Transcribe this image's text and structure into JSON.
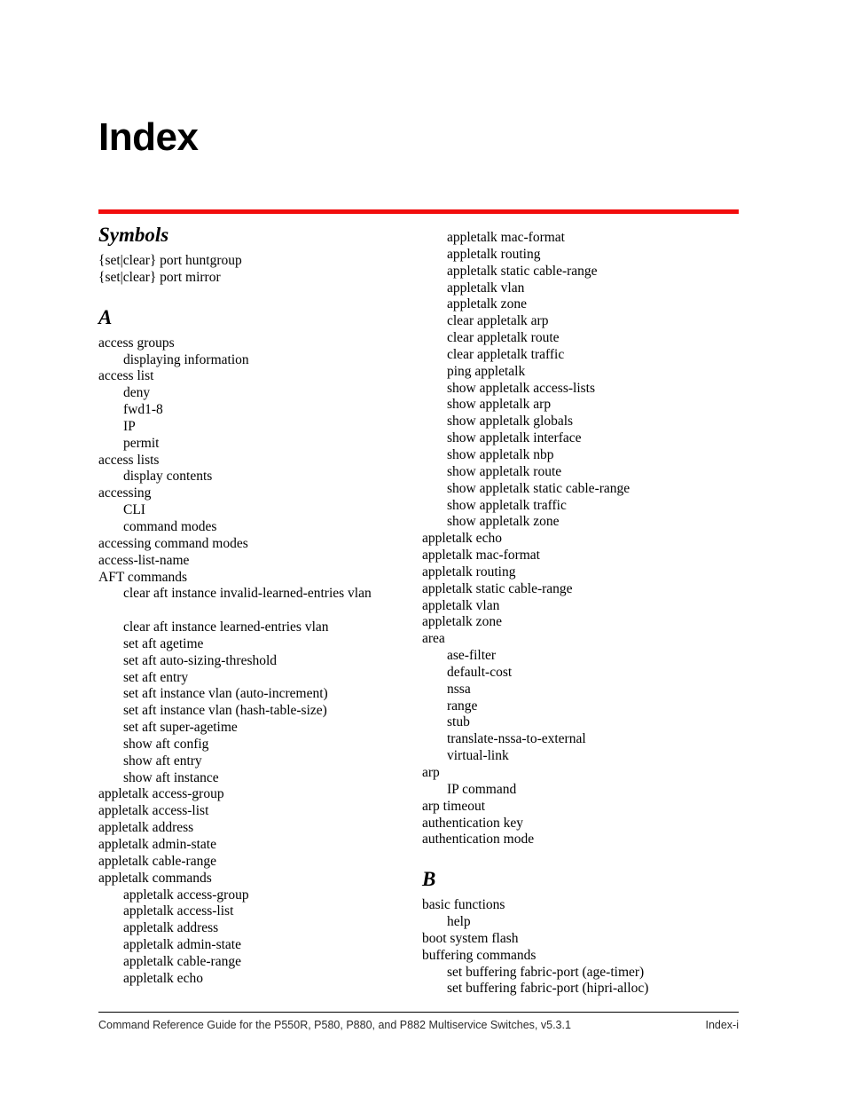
{
  "page": {
    "title": "Index",
    "accent_rule_color": "#f20d0d",
    "background_color": "#ffffff",
    "text_color": "#000000"
  },
  "columns": {
    "left": {
      "sections": [
        {
          "heading": "Symbols",
          "entries": [
            {
              "text": "{set|clear} port huntgroup",
              "level": 0
            },
            {
              "text": "{set|clear} port mirror",
              "level": 0
            }
          ]
        },
        {
          "heading": "A",
          "entries": [
            {
              "text": "access groups",
              "level": 0
            },
            {
              "text": "displaying information",
              "level": 1
            },
            {
              "text": "access list",
              "level": 0
            },
            {
              "text": "deny",
              "level": 1
            },
            {
              "text": "fwd1-8",
              "level": 1
            },
            {
              "text": "IP",
              "level": 1
            },
            {
              "text": "permit",
              "level": 1
            },
            {
              "text": "access lists",
              "level": 0
            },
            {
              "text": "display contents",
              "level": 1
            },
            {
              "text": "accessing",
              "level": 0
            },
            {
              "text": "CLI",
              "level": 1
            },
            {
              "text": "command modes",
              "level": 1
            },
            {
              "text": "accessing command modes",
              "level": 0
            },
            {
              "text": "access-list-name",
              "level": 0
            },
            {
              "text": "AFT commands",
              "level": 0
            },
            {
              "text": "clear aft instance invalid-learned-entries vlan",
              "level": 1
            },
            {
              "text": "",
              "level": 1,
              "spacer": true
            },
            {
              "text": "clear aft instance learned-entries vlan",
              "level": 1
            },
            {
              "text": "set aft agetime",
              "level": 1
            },
            {
              "text": "set aft auto-sizing-threshold",
              "level": 1
            },
            {
              "text": "set aft entry",
              "level": 1
            },
            {
              "text": "set aft instance vlan (auto-increment)",
              "level": 1
            },
            {
              "text": "set aft instance vlan (hash-table-size)",
              "level": 1
            },
            {
              "text": "set aft super-agetime",
              "level": 1
            },
            {
              "text": "show aft config",
              "level": 1
            },
            {
              "text": "show aft entry",
              "level": 1
            },
            {
              "text": "show aft instance",
              "level": 1
            },
            {
              "text": "appletalk access-group",
              "level": 0
            },
            {
              "text": "appletalk access-list",
              "level": 0
            },
            {
              "text": "appletalk address",
              "level": 0
            },
            {
              "text": "appletalk admin-state",
              "level": 0
            },
            {
              "text": "appletalk cable-range",
              "level": 0
            },
            {
              "text": "appletalk commands",
              "level": 0
            },
            {
              "text": "appletalk access-group",
              "level": 1
            },
            {
              "text": "appletalk access-list",
              "level": 1
            },
            {
              "text": "appletalk address",
              "level": 1
            },
            {
              "text": "appletalk admin-state",
              "level": 1
            },
            {
              "text": "appletalk cable-range",
              "level": 1
            },
            {
              "text": "appletalk echo",
              "level": 1
            }
          ]
        }
      ]
    },
    "right": {
      "sections": [
        {
          "heading": "",
          "entries": [
            {
              "text": "appletalk mac-format",
              "level": 1
            },
            {
              "text": "appletalk routing",
              "level": 1
            },
            {
              "text": "appletalk static cable-range",
              "level": 1
            },
            {
              "text": "appletalk vlan",
              "level": 1
            },
            {
              "text": "appletalk zone",
              "level": 1
            },
            {
              "text": "clear appletalk arp",
              "level": 1
            },
            {
              "text": "clear appletalk route",
              "level": 1
            },
            {
              "text": "clear appletalk traffic",
              "level": 1
            },
            {
              "text": "ping appletalk",
              "level": 1
            },
            {
              "text": "show appletalk access-lists",
              "level": 1
            },
            {
              "text": "show appletalk arp",
              "level": 1
            },
            {
              "text": "show appletalk globals",
              "level": 1
            },
            {
              "text": "show appletalk interface",
              "level": 1
            },
            {
              "text": "show appletalk nbp",
              "level": 1
            },
            {
              "text": "show appletalk route",
              "level": 1
            },
            {
              "text": "show appletalk static cable-range",
              "level": 1
            },
            {
              "text": "show appletalk traffic",
              "level": 1
            },
            {
              "text": "show appletalk zone",
              "level": 1
            },
            {
              "text": "appletalk echo",
              "level": 0
            },
            {
              "text": "appletalk mac-format",
              "level": 0
            },
            {
              "text": "appletalk routing",
              "level": 0
            },
            {
              "text": "appletalk static cable-range",
              "level": 0
            },
            {
              "text": "appletalk vlan",
              "level": 0
            },
            {
              "text": "appletalk zone",
              "level": 0
            },
            {
              "text": "area",
              "level": 0
            },
            {
              "text": "ase-filter",
              "level": 1
            },
            {
              "text": "default-cost",
              "level": 1
            },
            {
              "text": "nssa",
              "level": 1
            },
            {
              "text": "range",
              "level": 1
            },
            {
              "text": "stub",
              "level": 1
            },
            {
              "text": "translate-nssa-to-external",
              "level": 1
            },
            {
              "text": "virtual-link",
              "level": 1
            },
            {
              "text": "arp",
              "level": 0
            },
            {
              "text": "IP command",
              "level": 1
            },
            {
              "text": "arp timeout",
              "level": 0
            },
            {
              "text": "authentication key",
              "level": 0
            },
            {
              "text": "authentication mode",
              "level": 0
            }
          ]
        },
        {
          "heading": "B",
          "entries": [
            {
              "text": "basic functions",
              "level": 0
            },
            {
              "text": "help",
              "level": 1
            },
            {
              "text": "boot system flash",
              "level": 0
            },
            {
              "text": "buffering commands",
              "level": 0
            },
            {
              "text": "set buffering fabric-port (age-timer)",
              "level": 1
            },
            {
              "text": "set buffering fabric-port (hipri-alloc)",
              "level": 1
            }
          ]
        }
      ]
    }
  },
  "footer": {
    "left": "Command Reference Guide for the P550R, P580, P880, and P882 Multiservice Switches, v5.3.1",
    "right": "Index-i"
  }
}
